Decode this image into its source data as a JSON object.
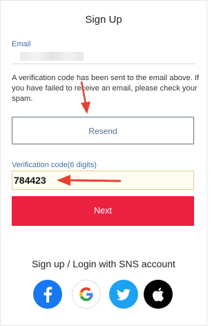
{
  "page": {
    "title": "Sign Up"
  },
  "email": {
    "label": "Email"
  },
  "notice": {
    "text": "A verification code has been sent to the email above. If you have failed to receive an email, please check your spam."
  },
  "resend": {
    "label": "Resend"
  },
  "verification": {
    "label": "Verification code(6 digits)",
    "value": "784423"
  },
  "next": {
    "label": "Next"
  },
  "sns": {
    "title": "Sign up / Login with SNS account",
    "providers": [
      {
        "name": "facebook",
        "icon": "facebook-icon",
        "color": "#1877f2"
      },
      {
        "name": "google",
        "icon": "google-icon",
        "color": "#ffffff"
      },
      {
        "name": "twitter",
        "icon": "twitter-icon",
        "color": "#1da1f2"
      },
      {
        "name": "apple",
        "icon": "apple-icon",
        "color": "#000000"
      }
    ]
  },
  "colors": {
    "accent_red": "#ec2040",
    "label_blue": "#3f6ea8",
    "annotation_arrow": "#e8412f"
  }
}
